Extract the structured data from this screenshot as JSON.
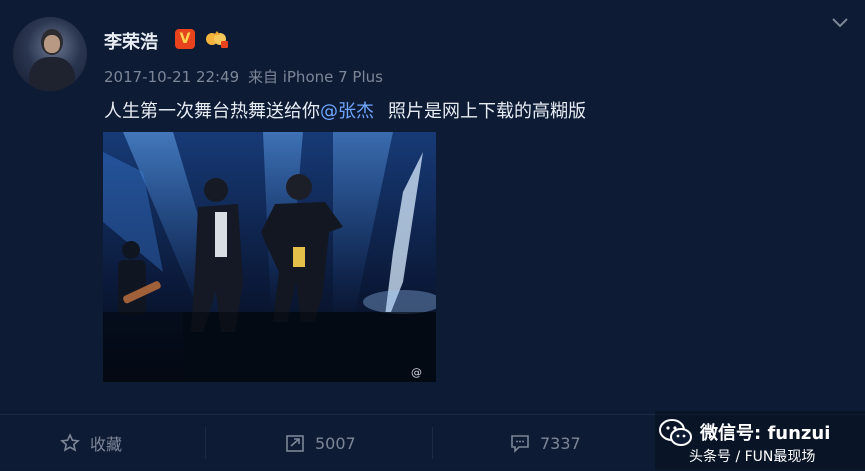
{
  "user": {
    "name": "李荣浩",
    "timestamp": "2017-10-21 22:49",
    "source": "来自 iPhone 7 Plus"
  },
  "post": {
    "text_before": "人生第一次舞台热舞送给你",
    "mention": "@张杰",
    "text_after": "照片是网上下载的高糊版",
    "image_watermark": "@"
  },
  "actions": {
    "favorite_label": "收藏",
    "repost_count": "5007",
    "comment_count": "7337"
  },
  "overlay": {
    "line1": "微信号: funzui",
    "line2": "头条号 / FUN最现场"
  },
  "icons": [
    "v-badge-icon",
    "crown-badge-icon",
    "chevron-down-icon",
    "star-icon",
    "repost-icon",
    "comment-icon",
    "wechat-icon"
  ],
  "colors": {
    "background": "#0e1b35",
    "mention": "#6fa6ff",
    "v_badge": "#e8431d"
  }
}
